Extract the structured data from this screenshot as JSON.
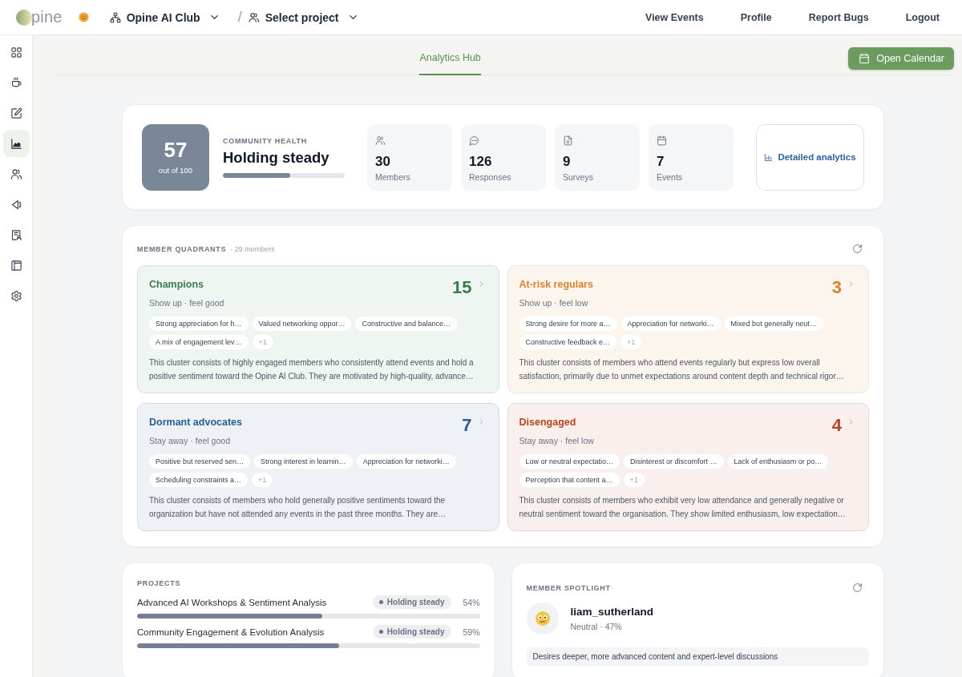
{
  "header": {
    "logo_text": "pine",
    "organization": "Opine AI Club",
    "separator": "/",
    "project_selector": "Select project",
    "nav": [
      "View Events",
      "Profile",
      "Report Bugs",
      "Logout"
    ]
  },
  "sidebar": {
    "items": [
      {
        "selected": false
      },
      {
        "selected": false
      },
      {
        "selected": false
      },
      {
        "selected": true
      },
      {
        "selected": false
      },
      {
        "selected": false
      },
      {
        "selected": false
      },
      {
        "selected": false
      },
      {
        "selected": false
      }
    ]
  },
  "tabs": [
    {
      "label": "Analytics Hub",
      "selected": true
    }
  ],
  "open_calendar_button": "Open Calendar",
  "community_health": {
    "score": "57",
    "score_caption": "out of 100",
    "label": "COMMUNITY HEALTH",
    "status": "Holding steady",
    "level": 0.55
  },
  "stats": [
    {
      "value": "30",
      "label": "Members"
    },
    {
      "value": "126",
      "label": "Responses"
    },
    {
      "value": "9",
      "label": "Surveys"
    },
    {
      "value": "7",
      "label": "Events"
    }
  ],
  "detailed_analytics_button": "Detailed analytics",
  "member_quadrants": {
    "title": "MEMBER QUADRANTS",
    "member_count": "· 29 members",
    "quadrants": [
      {
        "name": "Champions",
        "count": "15",
        "subtitle": "Show up · feel good",
        "color": "#3b7d4c",
        "tags": [
          "Strong appreciation for h…",
          "Valued networking oppor…",
          "Constructive and balance…",
          "A mix of engagement lev…"
        ],
        "more": "+1",
        "description": "This cluster consists of highly engaged members who consistently attend events and hold a positive sentiment toward the Opine AI Club. They are motivated by high-quality, advance…"
      },
      {
        "name": "At-risk regulars",
        "count": "3",
        "subtitle": "Show up · feel low",
        "color": "#d8822c",
        "tags": [
          "Strong desire for more a…",
          "Appreciation for networki…",
          "Mixed but generally neut…",
          "Constructive feedback e…"
        ],
        "more": "+1",
        "description": "This cluster consists of members who attend events regularly but express low overall satisfaction, primarily due to unmet expectations around content depth and technical rigor…"
      },
      {
        "name": "Dormant advocates",
        "count": "7",
        "subtitle": "Stay away · feel good",
        "color": "#2d5e8f",
        "tags": [
          "Positive but reserved sen…",
          "Strong interest in learnin…",
          "Appreciation for networki…",
          "Scheduling constraints a…"
        ],
        "more": "+1",
        "description": "This cluster consists of members who hold generally positive sentiments toward the organization but have not attended any events in the past three months. They are…"
      },
      {
        "name": "Disengaged",
        "count": "4",
        "subtitle": "Stay away · feel low",
        "color": "#b3461f",
        "tags": [
          "Low or neutral expectatio…",
          "Disinterest or discomfort …",
          "Lack of enthusiasm or po…",
          "Perception that content a…"
        ],
        "more": "+1",
        "description": "This cluster consists of members who exhibit very low attendance and generally negative or neutral sentiment toward the organisation. They show limited enthusiasm, low expectation…"
      }
    ]
  },
  "projects": {
    "title": "PROJECTS",
    "items": [
      {
        "name": "Advanced AI Workshops & Sentiment Analysis",
        "status": "Holding steady",
        "percent": "54%",
        "level": 0.54
      },
      {
        "name": "Community Engagement & Evolution Analysis",
        "status": "Holding steady",
        "percent": "59%",
        "level": 0.59
      }
    ]
  },
  "member_spotlight": {
    "title": "MEMBER SPOTLIGHT",
    "name": "liam_sutherland",
    "sentiment": "Neutral · 47%",
    "quote": "Desires deeper, more advanced content and expert-level discussions"
  }
}
